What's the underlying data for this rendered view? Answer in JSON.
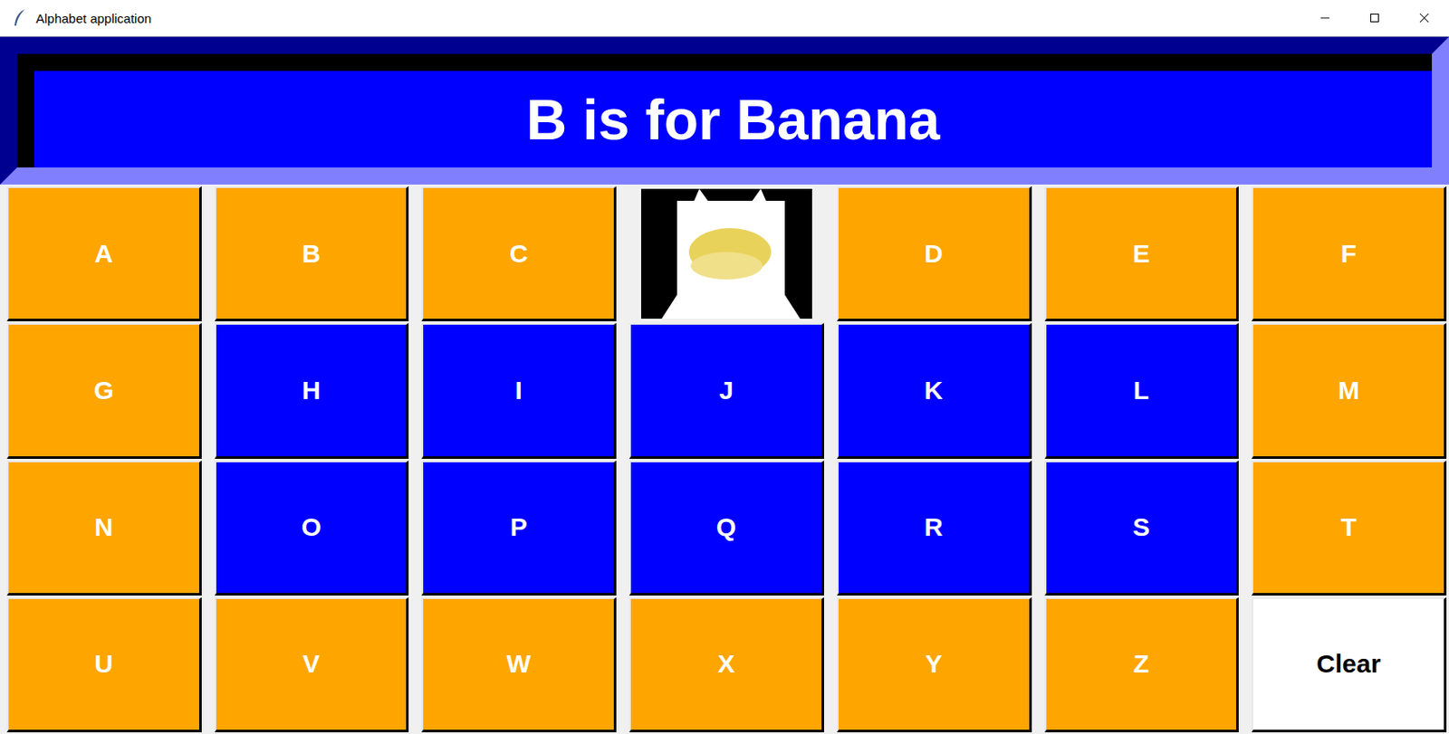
{
  "window": {
    "title": "Alphabet application"
  },
  "header": {
    "text": "B is for Banana"
  },
  "cells": [
    {
      "kind": "letter",
      "label": "A",
      "color": "#ffa500"
    },
    {
      "kind": "letter",
      "label": "B",
      "color": "#ffa500"
    },
    {
      "kind": "letter",
      "label": "C",
      "color": "#ffa500"
    },
    {
      "kind": "image",
      "label": "",
      "color": "#000000"
    },
    {
      "kind": "letter",
      "label": "D",
      "color": "#ffa500"
    },
    {
      "kind": "letter",
      "label": "E",
      "color": "#ffa500"
    },
    {
      "kind": "letter",
      "label": "F",
      "color": "#ffa500"
    },
    {
      "kind": "letter",
      "label": "G",
      "color": "#ffa500"
    },
    {
      "kind": "letter",
      "label": "H",
      "color": "#0000ff"
    },
    {
      "kind": "letter",
      "label": "I",
      "color": "#0000ff"
    },
    {
      "kind": "letter",
      "label": "J",
      "color": "#0000ff"
    },
    {
      "kind": "letter",
      "label": "K",
      "color": "#0000ff"
    },
    {
      "kind": "letter",
      "label": "L",
      "color": "#0000ff"
    },
    {
      "kind": "letter",
      "label": "M",
      "color": "#ffa500"
    },
    {
      "kind": "letter",
      "label": "N",
      "color": "#ffa500"
    },
    {
      "kind": "letter",
      "label": "O",
      "color": "#0000ff"
    },
    {
      "kind": "letter",
      "label": "P",
      "color": "#0000ff"
    },
    {
      "kind": "letter",
      "label": "Q",
      "color": "#0000ff"
    },
    {
      "kind": "letter",
      "label": "R",
      "color": "#0000ff"
    },
    {
      "kind": "letter",
      "label": "S",
      "color": "#0000ff"
    },
    {
      "kind": "letter",
      "label": "T",
      "color": "#ffa500"
    },
    {
      "kind": "letter",
      "label": "U",
      "color": "#ffa500"
    },
    {
      "kind": "letter",
      "label": "V",
      "color": "#ffa500"
    },
    {
      "kind": "letter",
      "label": "W",
      "color": "#ffa500"
    },
    {
      "kind": "letter",
      "label": "X",
      "color": "#ffa500"
    },
    {
      "kind": "letter",
      "label": "Y",
      "color": "#ffa500"
    },
    {
      "kind": "letter",
      "label": "Z",
      "color": "#ffa500"
    },
    {
      "kind": "button",
      "label": "Clear",
      "color": "#ffffff"
    }
  ]
}
